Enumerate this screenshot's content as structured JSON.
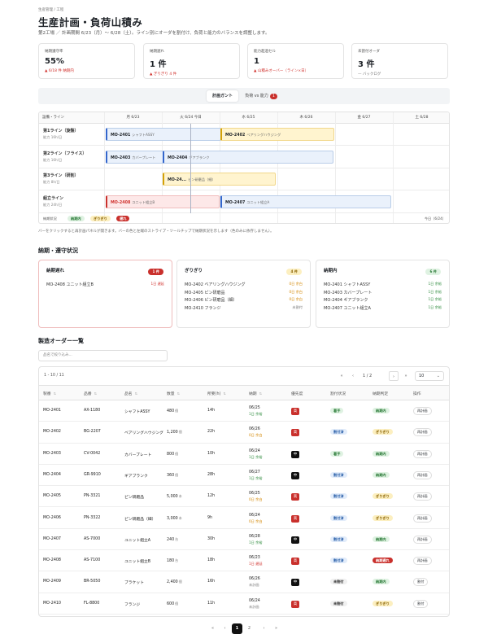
{
  "breadcrumb": "生産管理 / 工程",
  "title": "生産計画・負荷山積み",
  "subtitle": "第2工場 ／ 計画期間 6/23（月）〜 6/28（土）。ライン別にオーダを割付け、負荷と能力のバランスを調整します。",
  "kpis": [
    {
      "label": "納期遵守率",
      "value": "55%",
      "sub": "▲ 6/18 件 納期内",
      "tone": "red"
    },
    {
      "label": "納期遅れ",
      "value": "1 件",
      "sub": "▲ ぎりぎり 4 件",
      "tone": "red"
    },
    {
      "label": "能力超過セル",
      "value": "1",
      "sub": "▲ 山積みオーバー（ライン×日）",
      "tone": "red"
    },
    {
      "label": "未割付オーダ",
      "value": "3 件",
      "sub": "— バックログ",
      "tone": "grey"
    }
  ],
  "view_toggle": {
    "gantt": "計画ガント",
    "load": "負荷 vs 能力",
    "load_badge": "1"
  },
  "gantt": {
    "header_label": "設備・ライン",
    "days": [
      "月 6/23",
      "火 6/24 今日",
      "水 6/25",
      "木 6/26",
      "金 6/27",
      "土 6/28"
    ],
    "lines": [
      {
        "name": "第1ライン（旋盤）",
        "cap": "能力 16h/日",
        "bars": [
          {
            "id": "MO-2401",
            "part": "シャフトASSY",
            "tone": "blue"
          },
          {
            "id": "MO-2402",
            "part": "ベアリングハウジング",
            "tone": "yellow"
          }
        ]
      },
      {
        "name": "第2ライン（フライス）",
        "cap": "能力 16h/日",
        "bars": [
          {
            "id": "MO-2403",
            "part": "カバープレート",
            "tone": "blue"
          },
          {
            "id": "MO-2404",
            "part": "ギアブランク",
            "tone": "blue"
          }
        ]
      },
      {
        "name": "第3ライン（研削）",
        "cap": "能力 8h/日",
        "bars": [
          {
            "id": "MO-24...",
            "part": "ピン研磨品（細）",
            "tone": "yellow"
          }
        ]
      },
      {
        "name": "組立ライン",
        "cap": "能力 24h/日",
        "bars": [
          {
            "id": "MO-2408",
            "part": "ユニット組立B",
            "tone": "red"
          },
          {
            "id": "MO-2407",
            "part": "ユニット組立A",
            "tone": "blue"
          }
        ]
      }
    ],
    "legend_label": "納期状況",
    "legend": [
      "納期内",
      "ぎりぎり",
      "遅れ"
    ],
    "today_label": "今日（6/24）"
  },
  "gantt_note": "バーをクリックすると再計画パネルが開きます。バーの色と左端のストライプ・ツールチップで納期状況を示します（色のみに依存しません）。",
  "status_section": {
    "title": "納期・遵守状況",
    "cards": [
      {
        "title": "納期遅れ",
        "count": "1 件",
        "tone": "red",
        "items": [
          {
            "label": "MO-2408 ユニット組立B",
            "right": "1日 遅延"
          }
        ]
      },
      {
        "title": "ぎりぎり",
        "count": "4 件",
        "tone": "yellow",
        "items": [
          {
            "label": "MO-2402 ベアリングハウジング",
            "right": "0日 余白"
          },
          {
            "label": "MO-2405 ピン研磨品",
            "right": "0日 余白"
          },
          {
            "label": "MO-2406 ピン研磨品（細）",
            "right": "0日 余白"
          },
          {
            "label": "MO-2410 フランジ",
            "right": "未割付"
          }
        ]
      },
      {
        "title": "納期内",
        "count": "6 件",
        "tone": "green",
        "items": [
          {
            "label": "MO-2401 シャフトASSY",
            "right": "1日 余裕"
          },
          {
            "label": "MO-2403 カバープレート",
            "right": "1日 余裕"
          },
          {
            "label": "MO-2404 ギアブランク",
            "right": "1日 余裕"
          },
          {
            "label": "MO-2407 ユニット組立A",
            "right": "1日 余裕"
          }
        ]
      }
    ]
  },
  "orders": {
    "title": "製造オーダー一覧",
    "search_placeholder": "品名で絞り込み...",
    "count": "1 - 10 / 11",
    "page_info": "1 / 2",
    "page_size": "10",
    "columns": [
      "製番",
      "品番",
      "品名",
      "数量",
      "所要(h)",
      "納期",
      "優先度",
      "割付状況",
      "納期判定",
      "操作"
    ],
    "rows": [
      {
        "mo": "MO-2401",
        "pn": "AX-1180",
        "name": "シャフトASSY",
        "qty": "480",
        "unit": "個",
        "hrs": "14h",
        "due": "06/25",
        "slack": "1日 余裕",
        "slack_tone": "green",
        "prio": "高",
        "prio_tone": "h",
        "alloc": "着手",
        "alloc_tone": "green",
        "judge": "納期内",
        "judge_tone": "green",
        "action": "再計画"
      },
      {
        "mo": "MO-2402",
        "pn": "BG-2207",
        "name": "ベアリングハウジング",
        "qty": "1,200",
        "unit": "個",
        "hrs": "22h",
        "due": "06/26",
        "slack": "0日 余白",
        "slack_tone": "orange",
        "prio": "高",
        "prio_tone": "h",
        "alloc": "割付済",
        "alloc_tone": "blue",
        "judge": "ぎりぎり",
        "judge_tone": "yellow",
        "action": "再計画"
      },
      {
        "mo": "MO-2403",
        "pn": "CV-0042",
        "name": "カバープレート",
        "qty": "800",
        "unit": "個",
        "hrs": "10h",
        "due": "06/24",
        "slack": "1日 余裕",
        "slack_tone": "green",
        "prio": "中",
        "prio_tone": "m",
        "alloc": "着手",
        "alloc_tone": "green",
        "judge": "納期内",
        "judge_tone": "green",
        "action": "再計画"
      },
      {
        "mo": "MO-2404",
        "pn": "GR-9910",
        "name": "ギアブランク",
        "qty": "360",
        "unit": "個",
        "hrs": "28h",
        "due": "06/27",
        "slack": "1日 余裕",
        "slack_tone": "green",
        "prio": "中",
        "prio_tone": "m",
        "alloc": "割付済",
        "alloc_tone": "blue",
        "judge": "納期内",
        "judge_tone": "green",
        "action": "再計画"
      },
      {
        "mo": "MO-2405",
        "pn": "PN-3321",
        "name": "ピン研磨品",
        "qty": "5,000",
        "unit": "本",
        "hrs": "12h",
        "due": "06/25",
        "slack": "0日 余白",
        "slack_tone": "orange",
        "prio": "高",
        "prio_tone": "h",
        "alloc": "割付済",
        "alloc_tone": "blue",
        "judge": "ぎりぎり",
        "judge_tone": "yellow",
        "action": "再計画"
      },
      {
        "mo": "MO-2406",
        "pn": "PN-3322",
        "name": "ピン研磨品（細）",
        "qty": "3,000",
        "unit": "本",
        "hrs": "9h",
        "due": "06/24",
        "slack": "0日 余白",
        "slack_tone": "orange",
        "prio": "高",
        "prio_tone": "h",
        "alloc": "割付済",
        "alloc_tone": "blue",
        "judge": "ぎりぎり",
        "judge_tone": "yellow",
        "action": "再計画"
      },
      {
        "mo": "MO-2407",
        "pn": "AS-7000",
        "name": "ユニット組立A",
        "qty": "240",
        "unit": "台",
        "hrs": "30h",
        "due": "06/28",
        "slack": "1日 余裕",
        "slack_tone": "green",
        "prio": "中",
        "prio_tone": "m",
        "alloc": "割付済",
        "alloc_tone": "blue",
        "judge": "納期内",
        "judge_tone": "green",
        "action": "再計画"
      },
      {
        "mo": "MO-2408",
        "pn": "AS-7100",
        "name": "ユニット組立B",
        "qty": "180",
        "unit": "台",
        "hrs": "18h",
        "due": "06/23",
        "slack": "1日 遅延",
        "slack_tone": "red",
        "prio": "高",
        "prio_tone": "h",
        "alloc": "割付済",
        "alloc_tone": "blue",
        "judge": "納期遅れ",
        "judge_tone": "red",
        "action": "再計画"
      },
      {
        "mo": "MO-2409",
        "pn": "BR-5050",
        "name": "ブラケット",
        "qty": "2,400",
        "unit": "個",
        "hrs": "16h",
        "due": "06/26",
        "slack": "未計画",
        "slack_tone": "grey",
        "prio": "中",
        "prio_tone": "m",
        "alloc": "未割付",
        "alloc_tone": "grey",
        "judge": "納期内",
        "judge_tone": "green",
        "action": "割付"
      },
      {
        "mo": "MO-2410",
        "pn": "FL-8800",
        "name": "フランジ",
        "qty": "600",
        "unit": "個",
        "hrs": "11h",
        "due": "06/24",
        "slack": "未計画",
        "slack_tone": "grey",
        "prio": "高",
        "prio_tone": "h",
        "alloc": "未割付",
        "alloc_tone": "grey",
        "judge": "ぎりぎり",
        "judge_tone": "yellow",
        "action": "割付"
      }
    ]
  },
  "pagination": {
    "pages": [
      "1",
      "2"
    ],
    "current": "1"
  }
}
